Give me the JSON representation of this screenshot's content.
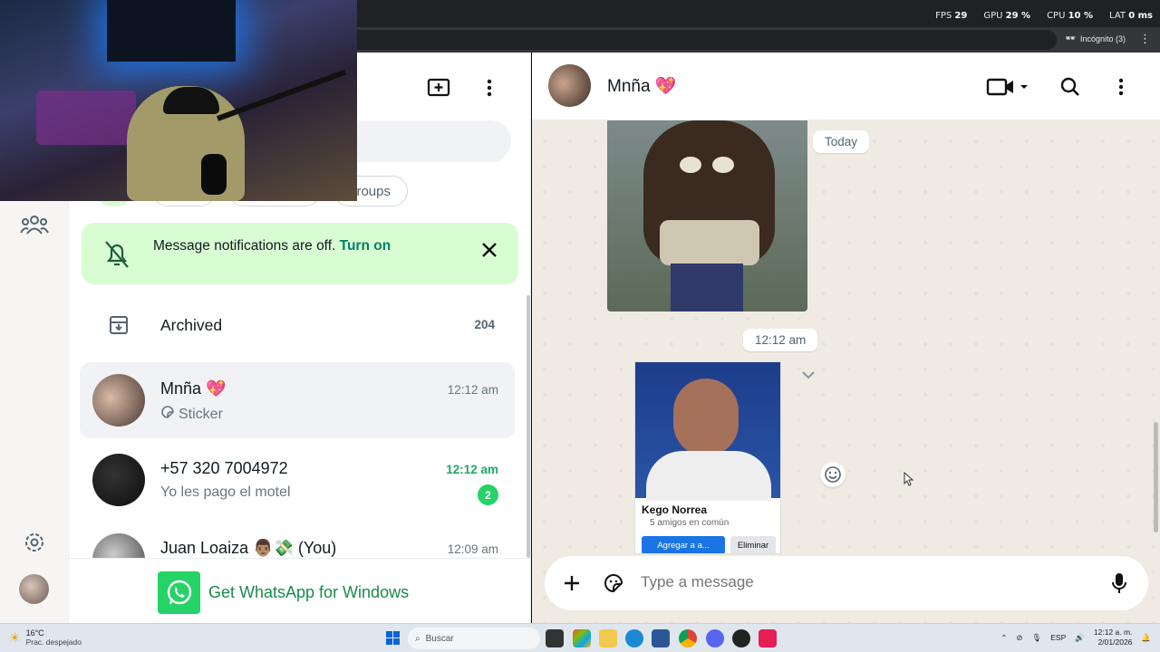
{
  "browser": {
    "perf": {
      "fps_label": "FPS",
      "fps": "29",
      "gpu_label": "GPU",
      "gpu": "29 %",
      "cpu_label": "CPU",
      "cpu": "10 %",
      "lat_label": "LAT",
      "lat": "0 ms"
    },
    "incognito": "Incógnito (3)"
  },
  "sidebar": {
    "icons": [
      "communities-icon",
      "settings-icon",
      "profile-avatar"
    ]
  },
  "chat_list": {
    "filters": [
      "roups"
    ],
    "notification": {
      "text": "Message notifications are off.",
      "link": "Turn on"
    },
    "archived": {
      "label": "Archived",
      "count": "204"
    },
    "chats": [
      {
        "name": "Mnña 💖",
        "preview": "Sticker",
        "time": "12:12 am",
        "unread": ""
      },
      {
        "name": "+57 320 7004972",
        "preview": "Yo les pago el motel",
        "time": "12:12 am",
        "unread": "2"
      },
      {
        "name": "Juan Loaiza 👨🏽💸 (You)",
        "preview": "",
        "time": "12:09 am",
        "unread": ""
      }
    ],
    "promo": "Get WhatsApp for Windows"
  },
  "conversation": {
    "contact_name": "Mnña 💖",
    "date_pill": "Today",
    "time_pill": "12:12 am",
    "card": {
      "name": "Kego Norrea",
      "friends": "5 amigos en común",
      "add_button": "Agregar a a...",
      "remove_button": "Eliminar"
    },
    "composer_placeholder": "Type a message"
  },
  "taskbar": {
    "temp": "16°C",
    "weather": "Prac. despejado",
    "search_placeholder": "Buscar",
    "lang": "ESP",
    "time": "12:12 a. m.",
    "date": "2/01/2026"
  },
  "colors": {
    "accent": "#25d366",
    "link": "#008069",
    "notif_bg": "#d9fdd3"
  }
}
